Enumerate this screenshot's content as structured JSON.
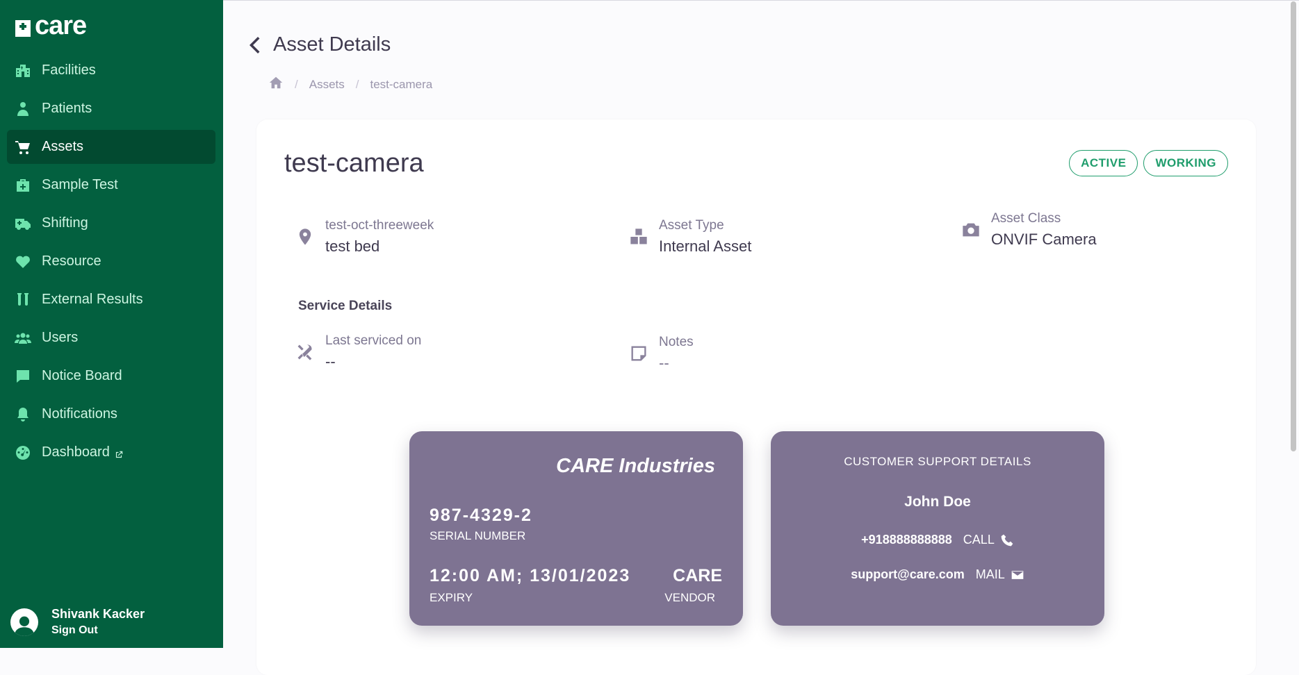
{
  "app": {
    "logo_text": "care"
  },
  "sidebar": {
    "items": [
      {
        "label": "Facilities"
      },
      {
        "label": "Patients"
      },
      {
        "label": "Assets"
      },
      {
        "label": "Sample Test"
      },
      {
        "label": "Shifting"
      },
      {
        "label": "Resource"
      },
      {
        "label": "External Results"
      },
      {
        "label": "Users"
      },
      {
        "label": "Notice Board"
      },
      {
        "label": "Notifications"
      },
      {
        "label": "Dashboard"
      }
    ],
    "active_item": "Assets",
    "user": {
      "name": "Shivank Kacker",
      "signout_label": "Sign Out"
    }
  },
  "header": {
    "title": "Asset Details",
    "breadcrumb": [
      "Assets",
      "test-camera"
    ]
  },
  "asset": {
    "name": "test-camera",
    "badges": [
      "ACTIVE",
      "WORKING"
    ],
    "location": {
      "label": "test-oct-threeweek",
      "value": "test bed"
    },
    "type": {
      "label": "Asset Type",
      "value": "Internal Asset"
    },
    "class": {
      "label": "Asset Class",
      "value": "ONVIF Camera"
    },
    "service_title": "Service Details",
    "last_serviced": {
      "label": "Last serviced on",
      "value": "--"
    },
    "notes": {
      "label": "Notes",
      "value": "--"
    }
  },
  "warranty_card": {
    "company": "CARE Industries",
    "serial": "987-4329-2",
    "serial_label": "SERIAL NUMBER",
    "expiry": "12:00 AM; 13/01/2023",
    "expiry_label": "EXPIRY",
    "vendor": "CARE",
    "vendor_label": "VENDOR"
  },
  "support_card": {
    "title": "CUSTOMER SUPPORT DETAILS",
    "name": "John Doe",
    "phone": "+918888888888",
    "call_label": "CALL",
    "email": "support@care.com",
    "mail_label": "MAIL"
  },
  "colors": {
    "sidebar_bg": "#03603f",
    "sidebar_active": "#024a30",
    "accent_green": "#1f9d6c",
    "card_purple": "#7e7392"
  }
}
